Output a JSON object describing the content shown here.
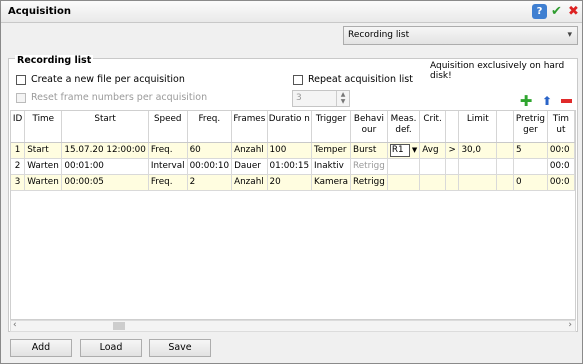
{
  "window": {
    "title": "Acquisition"
  },
  "titlebar_icons": {
    "help": "?",
    "ok": "✔",
    "close": "✖"
  },
  "dropdown": {
    "selected": "Recording list"
  },
  "group": {
    "label": "Recording list",
    "note": "Aquisition exclusively on hard disk!"
  },
  "options": {
    "new_file": "Create a new file per acquisition",
    "repeat_list": "Repeat acquisition list",
    "reset_frames": "Reset frame numbers per acquisition",
    "repeat_count": "3"
  },
  "table": {
    "headers": [
      "ID",
      "Time",
      "Start",
      "Speed",
      "Freq.",
      "Frames",
      "Duratio n",
      "Trigger",
      "Behavi our",
      "Meas. def.",
      "Crit.",
      "",
      "Limit",
      "",
      "Pretrig ger",
      "Tim ut"
    ],
    "rows": [
      [
        "1",
        "Start",
        "15.07.20 12:00:00",
        "Freq.",
        "60",
        "Anzahl",
        "100",
        "Temper",
        "Burst",
        "R1",
        "Avg",
        ">",
        "30,0",
        "",
        "5",
        "00:0"
      ],
      [
        "2",
        "Warten",
        "00:01:00",
        "Interval",
        "00:00:10",
        "Dauer",
        "01:00:15",
        "Inaktiv",
        "Retrigg",
        "",
        "",
        "",
        "",
        "",
        "",
        "00:0"
      ],
      [
        "3",
        "Warten",
        "00:00:05",
        "Freq.",
        "2",
        "Anzahl",
        "20",
        "Kamera",
        "Retrigg",
        "",
        "",
        "",
        "",
        "",
        "0",
        "00:0"
      ]
    ]
  },
  "buttons": {
    "add": "Add",
    "load": "Load",
    "save": "Save"
  },
  "icons": {
    "add": "plus-icon",
    "up": "arrow-up-icon",
    "remove": "minus-icon"
  },
  "colors": {
    "row_highlight": "#fffde0",
    "accent_green": "#2fa52f",
    "accent_red": "#e02a2a",
    "accent_blue": "#2a64c8"
  }
}
